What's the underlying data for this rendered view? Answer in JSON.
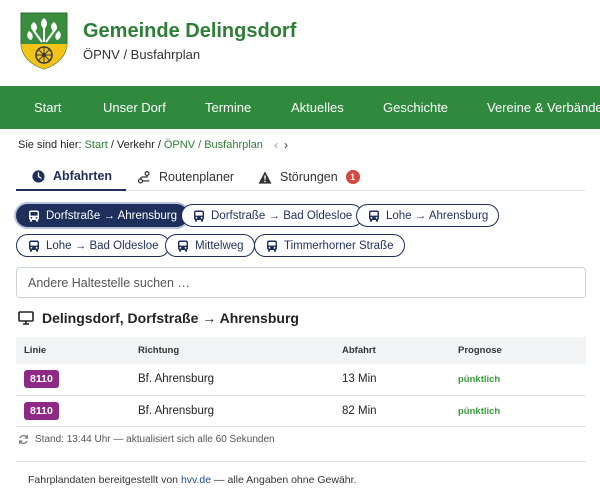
{
  "header": {
    "title": "Gemeinde Delingsdorf",
    "subtitle": "ÖPNV / Busfahrplan"
  },
  "nav": {
    "items": [
      {
        "label": "Start"
      },
      {
        "label": "Unser Dorf"
      },
      {
        "label": "Termine"
      },
      {
        "label": "Aktuelles"
      },
      {
        "label": "Geschichte"
      },
      {
        "label": "Vereine & Verbände"
      }
    ]
  },
  "breadcrumb": {
    "prefix": "Sie sind hier:",
    "items": [
      "Start",
      "Verkehr",
      "ÖPNV / Busfahrplan"
    ],
    "separator": "/",
    "prev_icon": "‹",
    "next_icon": "›"
  },
  "tabs": [
    {
      "label": "Abfahrten",
      "icon": "clock-icon",
      "active": true
    },
    {
      "label": "Routenplaner",
      "icon": "route-icon"
    },
    {
      "label": "Störungen",
      "icon": "warning-icon",
      "badge": "1"
    }
  ],
  "stops": [
    {
      "label": "Dorfstraße → Ahrensburg",
      "active": true
    },
    {
      "label": "Dorfstraße → Bad Oldesloe"
    },
    {
      "label": "Lohe → Ahrensburg"
    },
    {
      "label": "Lohe → Bad Oldesloe"
    },
    {
      "label": "Mittelweg"
    },
    {
      "label": "Timmerhorner Straße"
    }
  ],
  "search": {
    "placeholder": "Andere Haltestelle suchen …",
    "value": ""
  },
  "departures": {
    "title": "Delingsdorf, Dorfstraße → Ahrensburg",
    "columns": [
      "Linie",
      "Richtung",
      "Abfahrt",
      "Prognose"
    ],
    "rows": [
      {
        "line": "8110",
        "direction": "Bf. Ahrensburg",
        "departure": "13 Min",
        "forecast": "pünktlich"
      },
      {
        "line": "8110",
        "direction": "Bf. Ahrensburg",
        "departure": "82 Min",
        "forecast": "pünktlich"
      }
    ],
    "status": "Stand: 13:44 Uhr — aktualisiert sich alle 60 Sekunden"
  },
  "footer": {
    "text_before": "Fahrplandaten bereitgestellt von",
    "link": "hvv.de",
    "text_after": "— alle Angaben ohne Gewähr."
  },
  "colors": {
    "brand_green": "#2f8a3e",
    "title_green": "#2f7d36",
    "navy": "#1e2f5c",
    "line_badge": "#8e2a86",
    "ontime": "#3d9a3d",
    "alert_badge": "#d9463d"
  }
}
